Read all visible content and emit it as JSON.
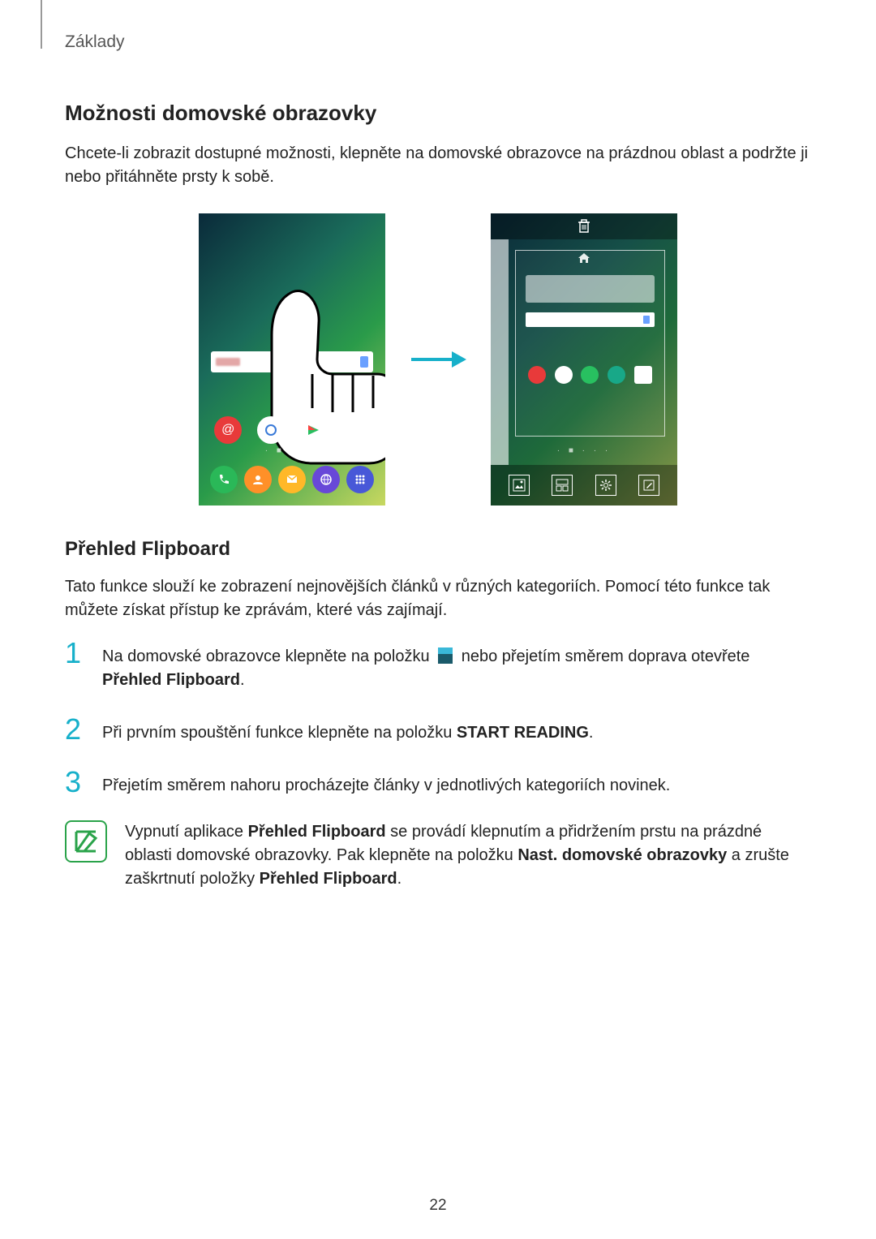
{
  "breadcrumb": "Základy",
  "section1": {
    "title": "Možnosti domovské obrazovky",
    "paragraph": "Chcete-li zobrazit dostupné možnosti, klepněte na domovské obrazovce na prázdnou oblast a podržte ji nebo přitáhněte prsty k sobě."
  },
  "section2": {
    "title": "Přehled Flipboard",
    "paragraph": "Tato funkce slouží ke zobrazení nejnovějších článků v různých kategoriích. Pomocí této funkce tak můžete získat přístup ke zprávám, které vás zajímají."
  },
  "steps": {
    "s1": {
      "num": "1",
      "t1": "Na domovské obrazovce klepněte na položku ",
      "t2": " nebo přejetím směrem doprava otevřete ",
      "bold": "Přehled Flipboard",
      "t3": "."
    },
    "s2": {
      "num": "2",
      "t1": "Při prvním spouštění funkce klepněte na položku ",
      "bold": "START READING",
      "t2": "."
    },
    "s3": {
      "num": "3",
      "text": "Přejetím směrem nahoru procházejte články v jednotlivých kategoriích novinek."
    }
  },
  "note": {
    "t1": "Vypnutí aplikace ",
    "b1": "Přehled Flipboard",
    "t2": " se provádí klepnutím a přidržením prstu na prázdné oblasti domovské obrazovky. Pak klepněte na položku ",
    "b2": "Nast. domovské obrazovky",
    "t3": " a zrušte zaškrtnutí položky ",
    "b3": "Přehled Flipboard",
    "t4": "."
  },
  "page_number": "22"
}
